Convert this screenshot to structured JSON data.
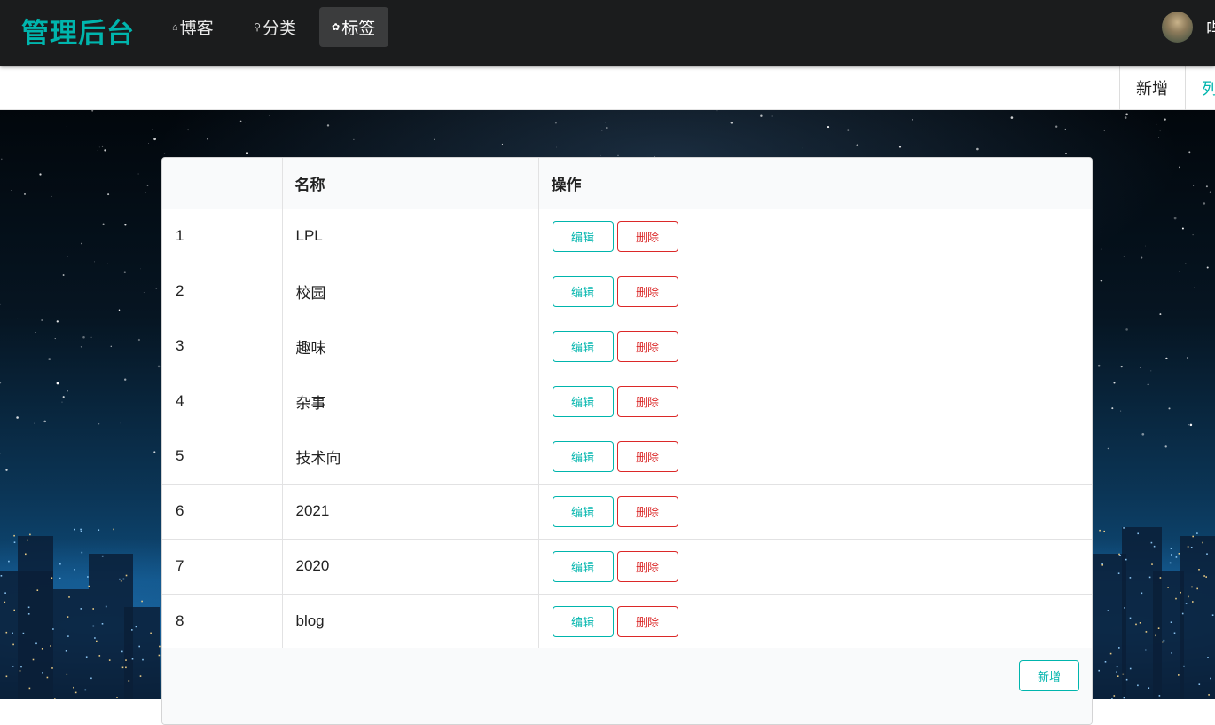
{
  "header": {
    "brand": "管理后台",
    "nav": [
      {
        "icon": "home-icon",
        "label": "博客"
      },
      {
        "icon": "idea-icon",
        "label": "分类"
      },
      {
        "icon": "tags-icon",
        "label": "标签"
      }
    ],
    "user_name": "哔"
  },
  "subnav": {
    "add_label": "新增",
    "list_label": "列"
  },
  "table": {
    "columns": [
      "",
      "名称",
      "操作"
    ],
    "rows": [
      {
        "index": "1",
        "name": "LPL"
      },
      {
        "index": "2",
        "name": "校园"
      },
      {
        "index": "3",
        "name": "趣味"
      },
      {
        "index": "4",
        "name": "杂事"
      },
      {
        "index": "5",
        "name": "技术向"
      },
      {
        "index": "6",
        "name": "2021"
      },
      {
        "index": "7",
        "name": "2020"
      },
      {
        "index": "8",
        "name": "blog"
      }
    ],
    "edit_label": "编辑",
    "delete_label": "删除",
    "add_label": "新增"
  },
  "colors": {
    "accent": "#00b5ad",
    "danger": "#db2828",
    "header_bg": "#1b1c1d"
  }
}
